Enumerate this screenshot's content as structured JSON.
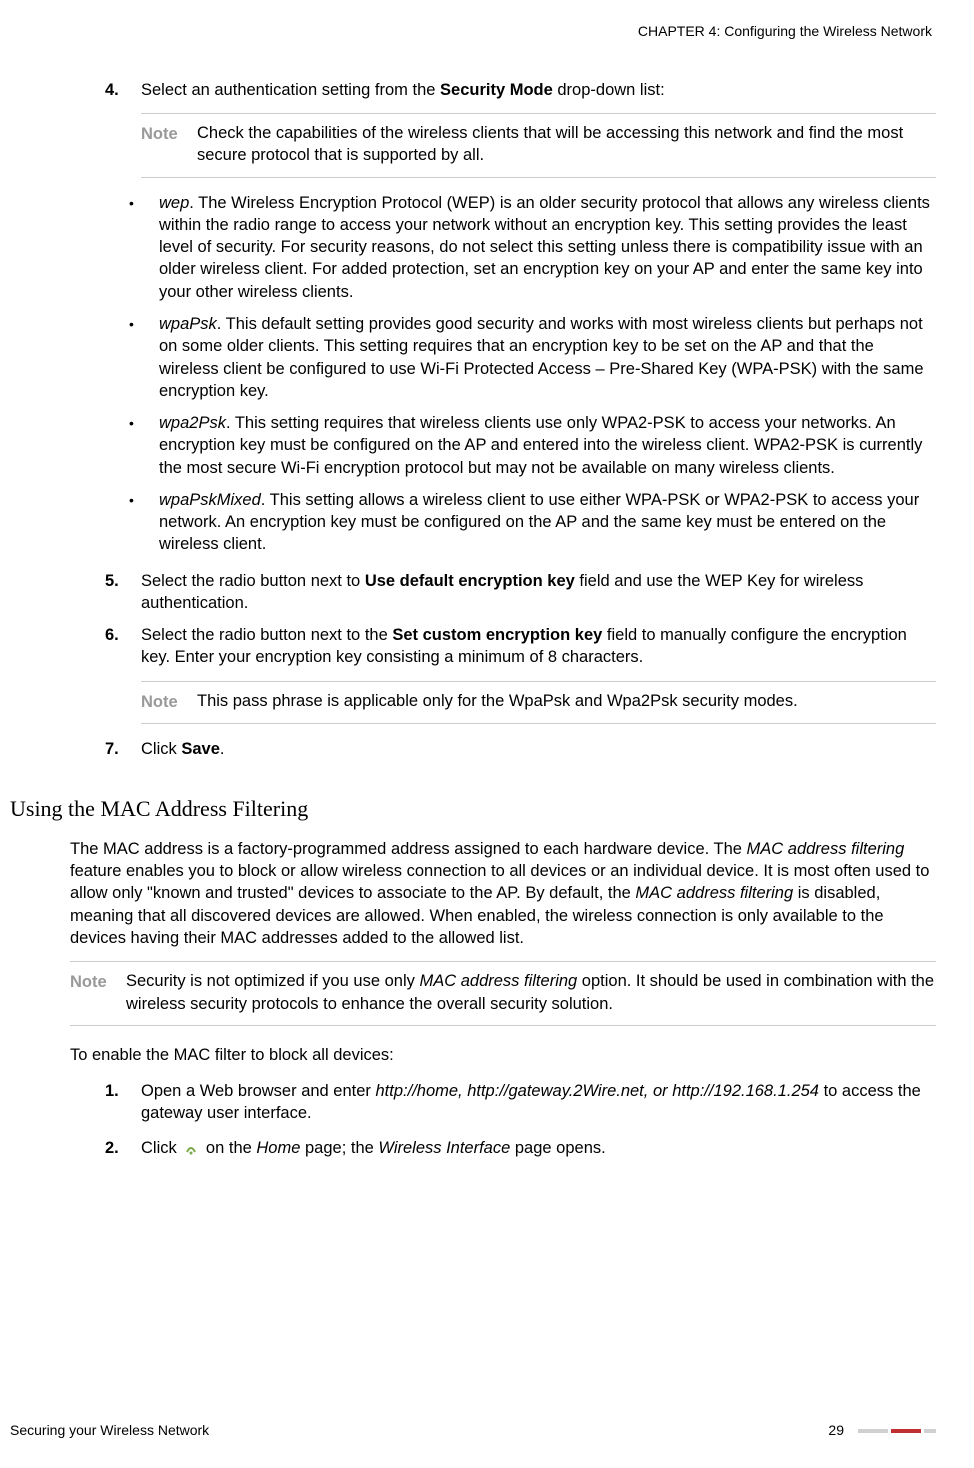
{
  "header": {
    "chapter": "CHAPTER 4: Configuring the Wireless Network"
  },
  "steps": {
    "s4": {
      "num": "4.",
      "prefix": "Select an authentication setting from the ",
      "bold": "Security Mode",
      "suffix": " drop-down list:"
    },
    "note1": {
      "label": "Note",
      "text": "Check the capabilities of the wireless clients that will be accessing this network and find the most secure protocol that is supported by all."
    },
    "bullets": {
      "wep": {
        "term": "wep",
        "text": ". The Wireless Encryption Protocol (WEP) is an older security protocol that allows any wireless clients within the radio range to access your network without an encryption key. This setting provides the least level of security. For security reasons, do not select this setting unless there is compatibility issue with an older wireless client. For added protection, set an encryption key on your AP and enter the same key into your other wireless clients."
      },
      "wpaPsk": {
        "term": "wpaPsk",
        "text": ". This default setting provides good security and works with most wireless clients but perhaps not on some older clients. This setting requires that an encryption key to be set on the AP and that the wireless client be configured to use Wi-Fi Protected Access – Pre-Shared Key (WPA-PSK) with the same encryption key."
      },
      "wpa2Psk": {
        "term": "wpa2Psk",
        "text": ". This setting requires that wireless clients use only WPA2-PSK to access your networks. An encryption key must be configured on the AP and entered into the wireless client. WPA2-PSK is currently the most secure Wi-Fi encryption protocol but may not be available on many wireless clients."
      },
      "wpaPskMixed": {
        "term": "wpaPskMixed",
        "text": ". This setting allows a wireless client to use either WPA-PSK or WPA2-PSK to access your network. An encryption key must be configured on the AP and the same key must be entered on the wireless client."
      }
    },
    "s5": {
      "num": "5.",
      "prefix": "Select the radio button next to ",
      "bold": "Use default encryption key",
      "suffix": " field and use the WEP Key for wireless authentication."
    },
    "s6": {
      "num": "6.",
      "prefix": "Select the radio button next to the ",
      "bold": "Set custom encryption key",
      "suffix": " field to manually configure the encryption key. Enter your encryption key consisting a minimum of 8 characters."
    },
    "note2": {
      "label": "Note",
      "text": "This pass phrase is applicable only for the WpaPsk and Wpa2Psk security modes."
    },
    "s7": {
      "num": "7.",
      "prefix": "Click ",
      "bold": "Save",
      "suffix": "."
    }
  },
  "section": {
    "heading": "Using the MAC Address Filtering",
    "intro_p1": "The MAC address is a factory-programmed address assigned to each hardware device. The ",
    "intro_i1": "MAC address filtering",
    "intro_p2": " feature enables you to block or allow wireless connection to all devices or an individual device. It is most often used to allow only \"known and trusted\" devices to associate to the AP. By default, the ",
    "intro_i2": "MAC address filtering",
    "intro_p3": " is disabled, meaning that all discovered devices are allowed. When enabled, the wireless connection is only available to the devices having their MAC addresses added to the allowed list.",
    "note3": {
      "label": "Note",
      "prefix": "Security is not optimized if you use only ",
      "italic": "MAC address filtering",
      "suffix": " option. It should be used in combination with the wireless security protocols to enhance the overall security solution."
    },
    "to_enable": "To enable the MAC filter to block all devices:",
    "sub_s1": {
      "num": "1.",
      "prefix": "Open a Web browser and enter ",
      "italic": "http://home, http://gateway.2Wire.net, or http://192.168.1.254",
      "suffix": " to access the gateway user interface."
    },
    "sub_s2": {
      "num": "2.",
      "prefix": "Click ",
      "mid": " on the ",
      "i1": "Home",
      "mid2": " page; the ",
      "i2": "Wireless Interface",
      "suffix": " page opens."
    }
  },
  "footer": {
    "left": "Securing your Wireless Network",
    "pagenum": "29"
  }
}
